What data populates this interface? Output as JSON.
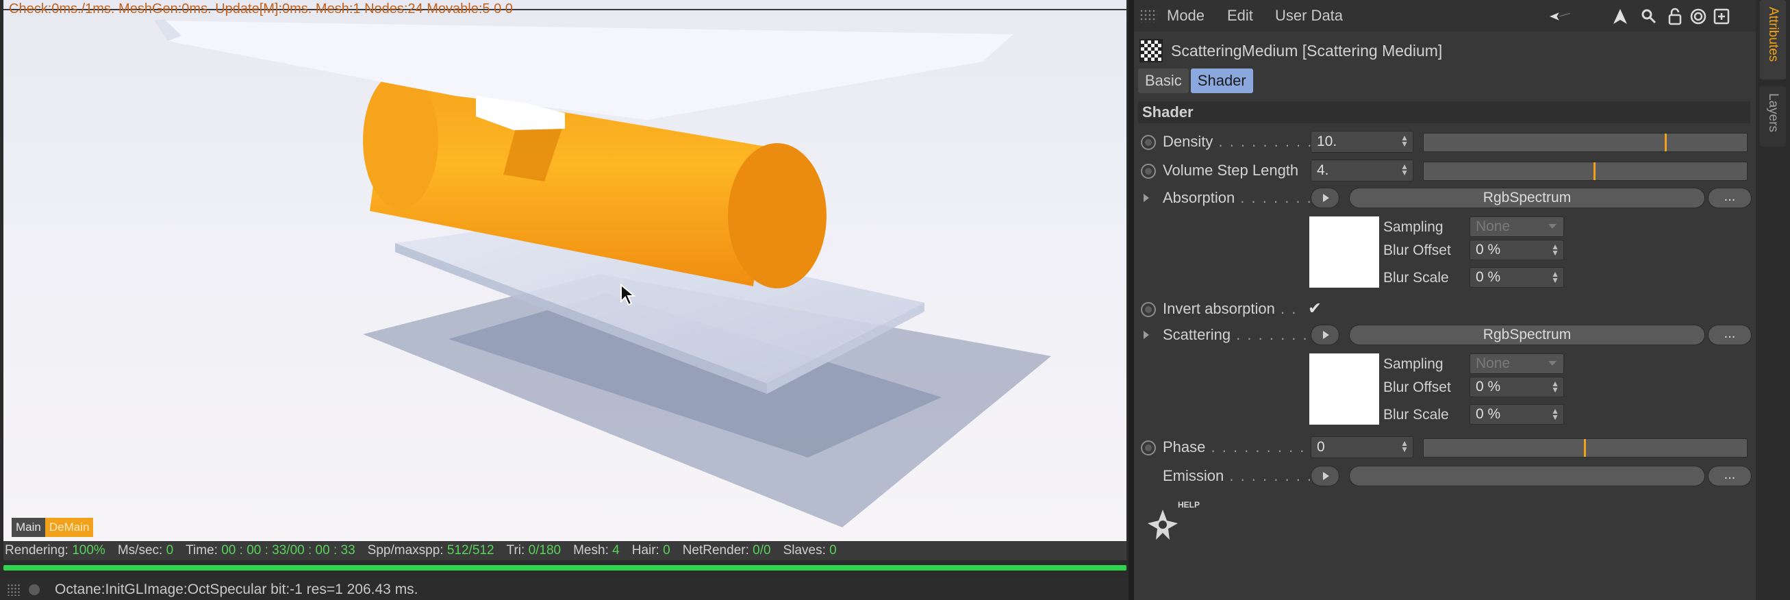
{
  "viewport": {
    "status_line": "Check:0ms./1ms. MeshGen:0ms. Update[M]:0ms. Mesh:1 Nodes:24 Movable:5  0 0",
    "tabs": [
      {
        "label": "Main"
      },
      {
        "label": "DeMain"
      }
    ],
    "stats": {
      "rendering_label": "Rendering:",
      "rendering_value": "100%",
      "mssec_label": "Ms/sec:",
      "mssec_value": "0",
      "time_label": "Time:",
      "time_value": "00 : 00 : 33/00 : 00 : 33",
      "spp_label": "Spp/maxspp:",
      "spp_value": "512/512",
      "tri_label": "Tri:",
      "tri_value": "0/180",
      "mesh_label": "Mesh:",
      "mesh_value": "4",
      "hair_label": "Hair:",
      "hair_value": "0",
      "netrender_label": "NetRender:",
      "netrender_value": "0/0",
      "slaves_label": "Slaves:",
      "slaves_value": "0"
    },
    "progress": 1.0,
    "console_text": "Octane:InitGLImage:OctSpecular  bit:-1 res=1  206.43 ms."
  },
  "menubar": {
    "items": [
      "Mode",
      "Edit",
      "User Data"
    ]
  },
  "object": {
    "title": "ScatteringMedium [Scattering Medium]",
    "tabs": [
      "Basic",
      "Shader"
    ],
    "active_tab": "Shader"
  },
  "section": {
    "title": "Shader"
  },
  "params": {
    "density": {
      "label": "Density",
      "dots": " . . . . . . . . . .",
      "value": "10.",
      "slider": 0.75
    },
    "volume_step": {
      "label": "Volume Step Length",
      "value": "4.",
      "slider": 0.53
    },
    "absorption": {
      "label": "Absorption",
      "dots": " . . . . . . .",
      "shader": "RgbSpectrum",
      "more": "...",
      "sampling_label": "Sampling",
      "sampling_value": "None",
      "blur_offset_label": "Blur Offset",
      "blur_offset_value": "0 %",
      "blur_scale_label": "Blur Scale",
      "blur_scale_value": "0 %"
    },
    "invert_absorption": {
      "label": "Invert absorption",
      "dots": " . .",
      "checked": "✔"
    },
    "scattering": {
      "label": "Scattering",
      "dots": " . . . . . . . .",
      "shader": "RgbSpectrum",
      "more": "...",
      "sampling_label": "Sampling",
      "sampling_value": "None",
      "blur_offset_label": "Blur Offset",
      "blur_offset_value": "0 %",
      "blur_scale_label": "Blur Scale",
      "blur_scale_value": "0 %"
    },
    "phase": {
      "label": "Phase",
      "dots": " . . . . . . . . . . . .",
      "value": "0",
      "slider": 0.5
    },
    "emission": {
      "label": "Emission",
      "dots": " . . . . . . . . . .",
      "more": "..."
    }
  },
  "help_label": "HELP",
  "side_tabs": [
    "Attributes",
    "Layers"
  ],
  "colors": {
    "accent": "#f2a21a",
    "progress": "#2fd34d",
    "tab_active": "#8aa8dd",
    "stat_value": "#58d25a"
  }
}
